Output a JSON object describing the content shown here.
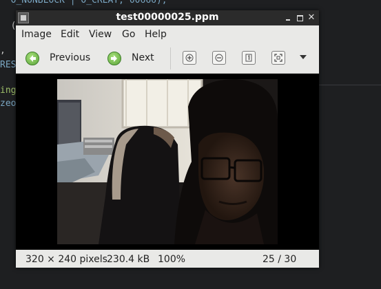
{
  "editor": {
    "lines": [
      "  O_NONBLOCK | O_CREAT, 00666);",
      "  (",
      ",",
      "RES",
      "ing",
      "zeo"
    ]
  },
  "window": {
    "title": "test00000025.ppm"
  },
  "menu": {
    "items": [
      "Image",
      "Edit",
      "View",
      "Go",
      "Help"
    ]
  },
  "toolbar": {
    "previous_label": "Previous",
    "next_label": "Next",
    "icons": [
      "previous-icon",
      "next-icon",
      "zoom-in-icon",
      "zoom-out-icon",
      "zoom-normal-icon",
      "zoom-fit-icon",
      "dropdown-arrow-icon"
    ]
  },
  "status": {
    "dimensions": "320 × 240 pixels",
    "size": "230.4 kB",
    "zoom": "100%",
    "position": "25 / 30"
  },
  "colors": {
    "titlebar": "#2b2b2b",
    "window_bg": "#e9e9e7",
    "canvas_bg": "#000000",
    "nav_green": "#5ca43a"
  }
}
